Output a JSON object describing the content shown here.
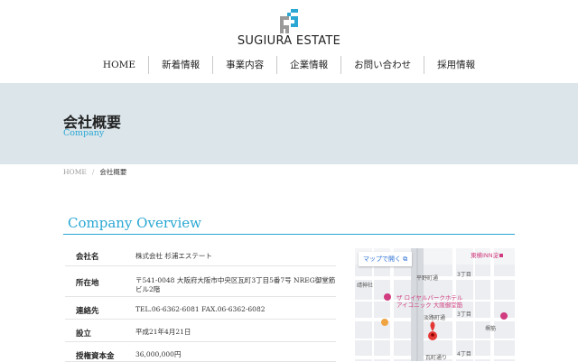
{
  "logo": {
    "text": "SUGIURA ESTATE",
    "colors": {
      "blue": "#2aa7d3",
      "gray": "#8c8c8c"
    }
  },
  "nav": [
    "HOME",
    "新着情報",
    "事業内容",
    "企業情報",
    "お問い合わせ",
    "採用情報"
  ],
  "hero": {
    "title": "会社概要",
    "subtitle": "Company",
    "bg": "#dbe5ea"
  },
  "breadcrumb": {
    "home": "HOME",
    "sep": "/",
    "current": "会社概要"
  },
  "section": {
    "title": "Company Overview",
    "accent": "#2aa7d3"
  },
  "info": [
    {
      "label": "会社名",
      "value": "株式会社 杉浦エステート"
    },
    {
      "label": "所在地",
      "value": "〒541-0048 大阪府大阪市中央区瓦町3丁目5番7号 NREG御堂筋ビル2階"
    },
    {
      "label": "連絡先",
      "value": "TEL.06-6362-6081 FAX.06-6362-6082"
    },
    {
      "label": "設立",
      "value": "平成21年4月21日"
    },
    {
      "label": "授権資本金",
      "value": "36,000,000円"
    }
  ],
  "map": {
    "button": "マップで開く",
    "labels": {
      "toyoko": "東横INN淀",
      "hiranomachi": "平野町通",
      "tsubomi": "靖神社",
      "hotel1": "ザ ロイヤルパークホテル",
      "hotel2": "アイコニック 大阪御堂筋",
      "awaji": "淡路町通",
      "chome3a": "3丁目",
      "chome3b": "3丁目",
      "kawaramachi": "瓦町通り",
      "chome4": "4丁目",
      "side": "堺筋"
    }
  }
}
